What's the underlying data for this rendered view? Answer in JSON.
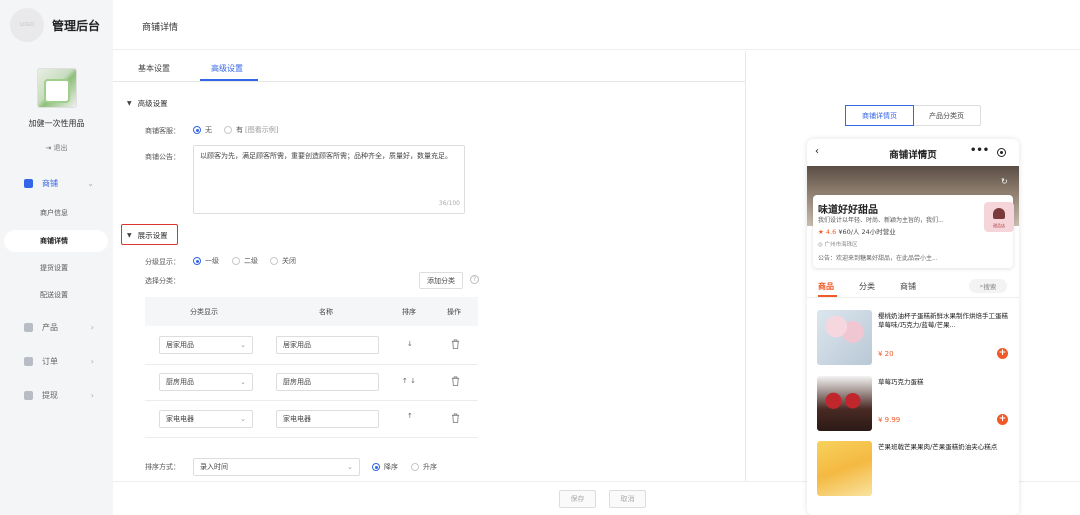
{
  "sidebar": {
    "logo_text": "LOGO",
    "app_title": "管理后台",
    "shop_name": "加健一次性用品",
    "logout": "退出",
    "nav": [
      {
        "label": "商铺",
        "active": true
      },
      {
        "label": "产品"
      },
      {
        "label": "订单"
      },
      {
        "label": "提现"
      }
    ],
    "sub_items": [
      "商户信息",
      "商铺详情",
      "提货设置",
      "配送设置"
    ]
  },
  "header": {
    "title": "商铺详情"
  },
  "tabs": [
    "基本设置",
    "高级设置"
  ],
  "advanced": {
    "section_title": "高级设置",
    "service_label": "商铺客服：",
    "service_options": [
      "无",
      "有"
    ],
    "service_hint": "[图看示例]",
    "notice_label": "商铺公告：",
    "notice_text": "以顾客为先，满足顾客所需，重要创造顾客所需；品种齐全，质量好，数量充足。",
    "notice_count": "36/100"
  },
  "display": {
    "section_title": "展示设置",
    "level_label": "分级显示：",
    "level_options": [
      "一级",
      "二级",
      "关闭"
    ],
    "select_label": "选择分类：",
    "add_button": "添加分类",
    "help": "?",
    "columns": [
      "分类显示",
      "名称",
      "排序",
      "操作"
    ],
    "rows": [
      {
        "category": "居家用品",
        "name": "居家用品",
        "sort": "↓"
      },
      {
        "category": "厨房用品",
        "name": "厨房用品",
        "sort": "↑ ↓"
      },
      {
        "category": "家电电器",
        "name": "家电电器",
        "sort": "↑"
      }
    ],
    "order_label": "排序方式：",
    "order_value": "录入时间",
    "order_options": [
      "降序",
      "升序"
    ]
  },
  "footer": {
    "save": "保存",
    "cancel": "取消"
  },
  "preview": {
    "tabs": [
      "商铺详情页",
      "产品分类页"
    ],
    "phone_title": "商铺详情页",
    "shop_name": "味道好好甜品",
    "slogan": "我们设计以年轻、时尚、新颖为主旨的，我们...",
    "rating": "4.6",
    "rating_rest": "¥60/人  24小时营业",
    "address": "广州市海珠区",
    "notice": "公告：欢迎来到糖果好甜品，在此品尝小主...",
    "avatar_text": "甜品店",
    "tabs_bar": [
      "商品",
      "分类",
      "商铺"
    ],
    "search": "搜索",
    "items": [
      {
        "name": "樱桃奶油杯子蛋糕新鲜水果制作烘焙手工蛋糕草莓味/巧克力/蓝莓/芒果...",
        "price": "¥ 20"
      },
      {
        "name": "草莓巧克力蛋糕",
        "price": "¥ 9.99"
      },
      {
        "name": "芒果班戟芒果果肉/芒果蛋糕奶油夹心糕点",
        "price": ""
      }
    ]
  }
}
